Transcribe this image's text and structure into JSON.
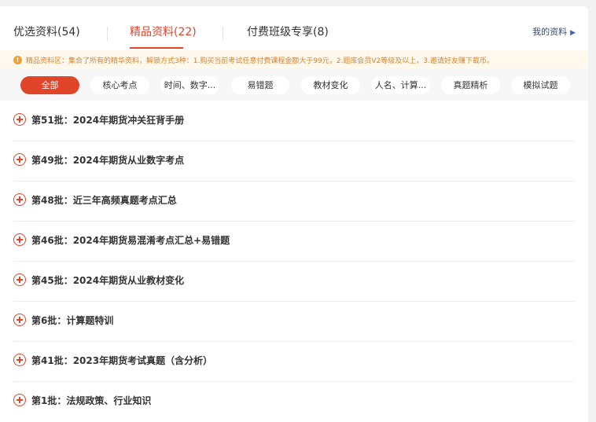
{
  "tabs": [
    {
      "label": "优选资料(54)",
      "active": false
    },
    {
      "label": "精品资料(22)",
      "active": true
    },
    {
      "label": "付费班级专享(8)",
      "active": false
    }
  ],
  "my_materials": {
    "label": "我的资料",
    "icon": "triangle-right-icon"
  },
  "notice": {
    "icon": "info-icon",
    "text": "精品资料区：集合了所有的精华资料，解锁方式3种：1.购买当前考试任意付费课程金额大于99元，2.题库会员V2等级及以上，3.邀请好友赚下载币。"
  },
  "filters": [
    {
      "label": "全部",
      "active": true
    },
    {
      "label": "核心考点",
      "active": false
    },
    {
      "label": "时间、数字...",
      "active": false
    },
    {
      "label": "易错题",
      "active": false
    },
    {
      "label": "教材变化",
      "active": false
    },
    {
      "label": "人名、计算...",
      "active": false
    },
    {
      "label": "真题精析",
      "active": false
    },
    {
      "label": "模拟试题",
      "active": false
    }
  ],
  "items": [
    {
      "label": "第51批：2024年期货冲关狂背手册"
    },
    {
      "label": "第49批：2024年期货从业数字考点"
    },
    {
      "label": "第48批：近三年高频真题考点汇总"
    },
    {
      "label": "第46批：2024年期货易混淆考点汇总+易错题"
    },
    {
      "label": "第45批：2024年期货从业教材变化"
    },
    {
      "label": "第6批：计算题特训"
    },
    {
      "label": "第41批：2023年期货考试真题（含分析）"
    },
    {
      "label": "第1批：法规政策、行业知识"
    }
  ],
  "colors": {
    "accent": "#e0452a",
    "notice_text": "#d9822b",
    "notice_bg": "#fff8ec"
  }
}
